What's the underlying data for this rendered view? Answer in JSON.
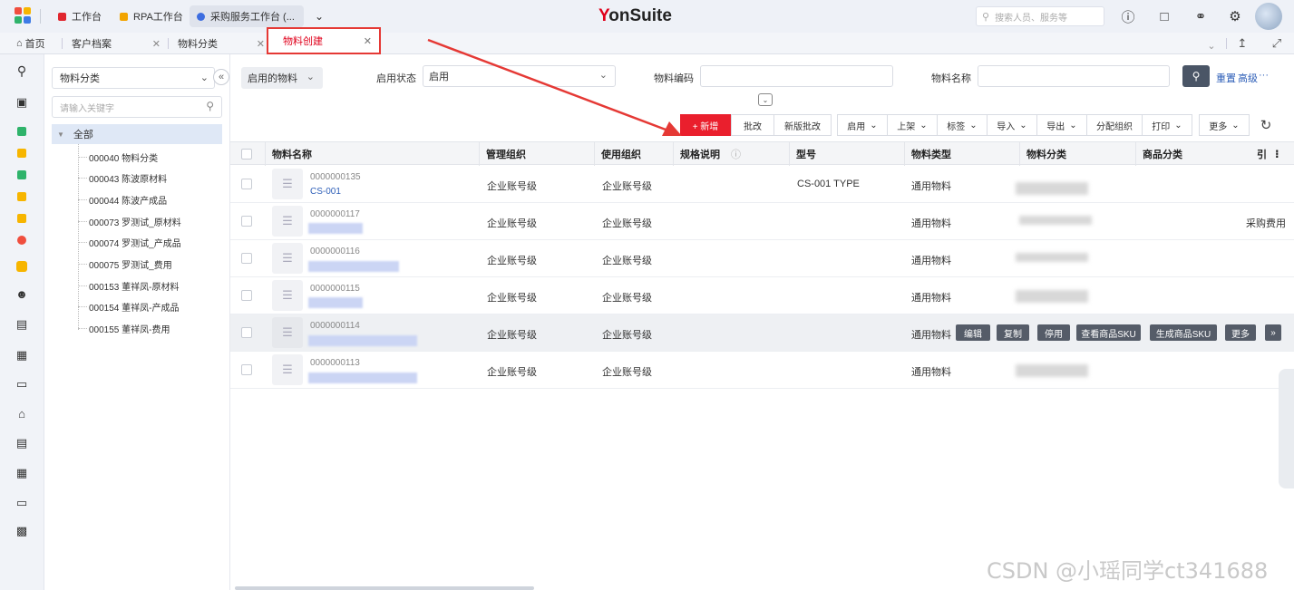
{
  "topbar": {
    "app_tabs": [
      {
        "label": "工作台",
        "color": "#e0262e"
      },
      {
        "label": "RPA工作台",
        "color": "#f2a400"
      },
      {
        "label": "采购服务工作台 (...",
        "color": "#3d6de0"
      }
    ],
    "more_apps_icon": "chevron-down-icon",
    "brand": {
      "y": "Y",
      "rest": "onSuite"
    },
    "search_placeholder": "搜索人员、服务等",
    "icons": [
      "help-icon",
      "message-icon",
      "headset-icon",
      "gear-icon"
    ]
  },
  "page_tabs": [
    {
      "label": "首页",
      "icon": "home-icon",
      "closable": false
    },
    {
      "label": "客户档案",
      "closable": true
    },
    {
      "label": "物料分类",
      "closable": true
    },
    {
      "label": "物料创建",
      "closable": true,
      "active": true
    }
  ],
  "page_tab_tools": {
    "collapse": "⌄",
    "pin": "↥",
    "fullscreen": "⤢"
  },
  "tree": {
    "select_value": "物料分类",
    "search_placeholder": "请输入关键字",
    "root_label": "全部",
    "items": [
      "000040 物料分类",
      "000043 陈波原材料",
      "000044 陈波产成品",
      "000073 罗测试_原材料",
      "000074 罗测试_产成品",
      "000075 罗测试_费用",
      "000153 董祥凤-原材料",
      "000154 董祥凤-产成品",
      "000155 董祥凤-费用"
    ]
  },
  "filters": {
    "scheme_value": "启用的物料",
    "status_label": "启用状态",
    "status_value": "启用",
    "code_label": "物料编码",
    "code_value": "",
    "name_label": "物料名称",
    "name_value": "",
    "reset_label": "重置",
    "advanced_label": "高级",
    "more_label": "···"
  },
  "toolbar": {
    "new_label": "+ 新增",
    "batch_edit_label": "批改",
    "new_batch_edit_label": "新版批改",
    "enable_label": "启用",
    "shelf_label": "上架",
    "tag_label": "标签",
    "import_label": "导入",
    "export_label": "导出",
    "assign_org_label": "分配组织",
    "print_label": "打印",
    "more_label": "更多"
  },
  "table": {
    "headers": [
      "物料名称",
      "管理组织",
      "使用组织",
      "规格说明",
      "型号",
      "物料类型",
      "物料分类",
      "商品分类",
      "引"
    ],
    "rows": [
      {
        "code": "0000000135",
        "name": "CS-001",
        "mgmt_org": "企业账号级",
        "use_org": "企业账号级",
        "model": "CS-001 TYPE",
        "type": "通用物料",
        "goods_class": ""
      },
      {
        "code": "0000000117",
        "name": "",
        "mgmt_org": "企业账号级",
        "use_org": "企业账号级",
        "model": "",
        "type": "通用物料",
        "goods_class": "采购费用"
      },
      {
        "code": "0000000116",
        "name": "",
        "mgmt_org": "企业账号级",
        "use_org": "企业账号级",
        "model": "",
        "type": "通用物料",
        "goods_class": ""
      },
      {
        "code": "0000000115",
        "name": "",
        "mgmt_org": "企业账号级",
        "use_org": "企业账号级",
        "model": "",
        "type": "通用物料",
        "goods_class": ""
      },
      {
        "code": "0000000114",
        "name": "",
        "mgmt_org": "企业账号级",
        "use_org": "企业账号级",
        "model": "",
        "type": "通用物料",
        "goods_class": ""
      },
      {
        "code": "0000000113",
        "name": "",
        "mgmt_org": "企业账号级",
        "use_org": "企业账号级",
        "model": "",
        "type": "通用物料",
        "goods_class": ""
      }
    ],
    "row_actions": [
      "编辑",
      "复制",
      "停用",
      "查看商品SKU",
      "生成商品SKU",
      "更多",
      "»"
    ]
  },
  "watermark": "CSDN @小瑶同学ct341688",
  "colors": {
    "accent": "#ea1f2d",
    "link": "#2e5fb8",
    "selected_tree": "#dfe8f6"
  }
}
